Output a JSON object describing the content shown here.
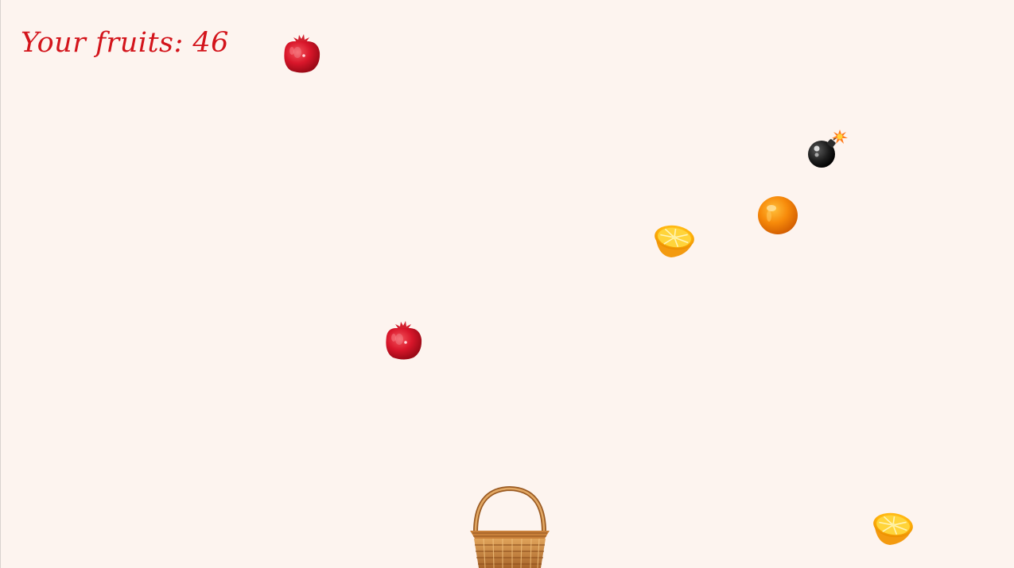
{
  "hud": {
    "score_label": "Your fruits: 46"
  },
  "sprites": [
    {
      "kind": "pomegranate",
      "icon": "pomegranate-icon"
    },
    {
      "kind": "bomb",
      "icon": "bomb-icon"
    },
    {
      "kind": "orange",
      "icon": "orange-icon"
    },
    {
      "kind": "orange-half",
      "icon": "orange-half-icon"
    },
    {
      "kind": "pomegranate",
      "icon": "pomegranate-icon"
    },
    {
      "kind": "orange-half",
      "icon": "orange-half-icon"
    }
  ],
  "player": {
    "kind": "basket",
    "icon": "basket-icon"
  },
  "colors": {
    "background": "#fdf4ef",
    "score_text": "#d3141b"
  }
}
